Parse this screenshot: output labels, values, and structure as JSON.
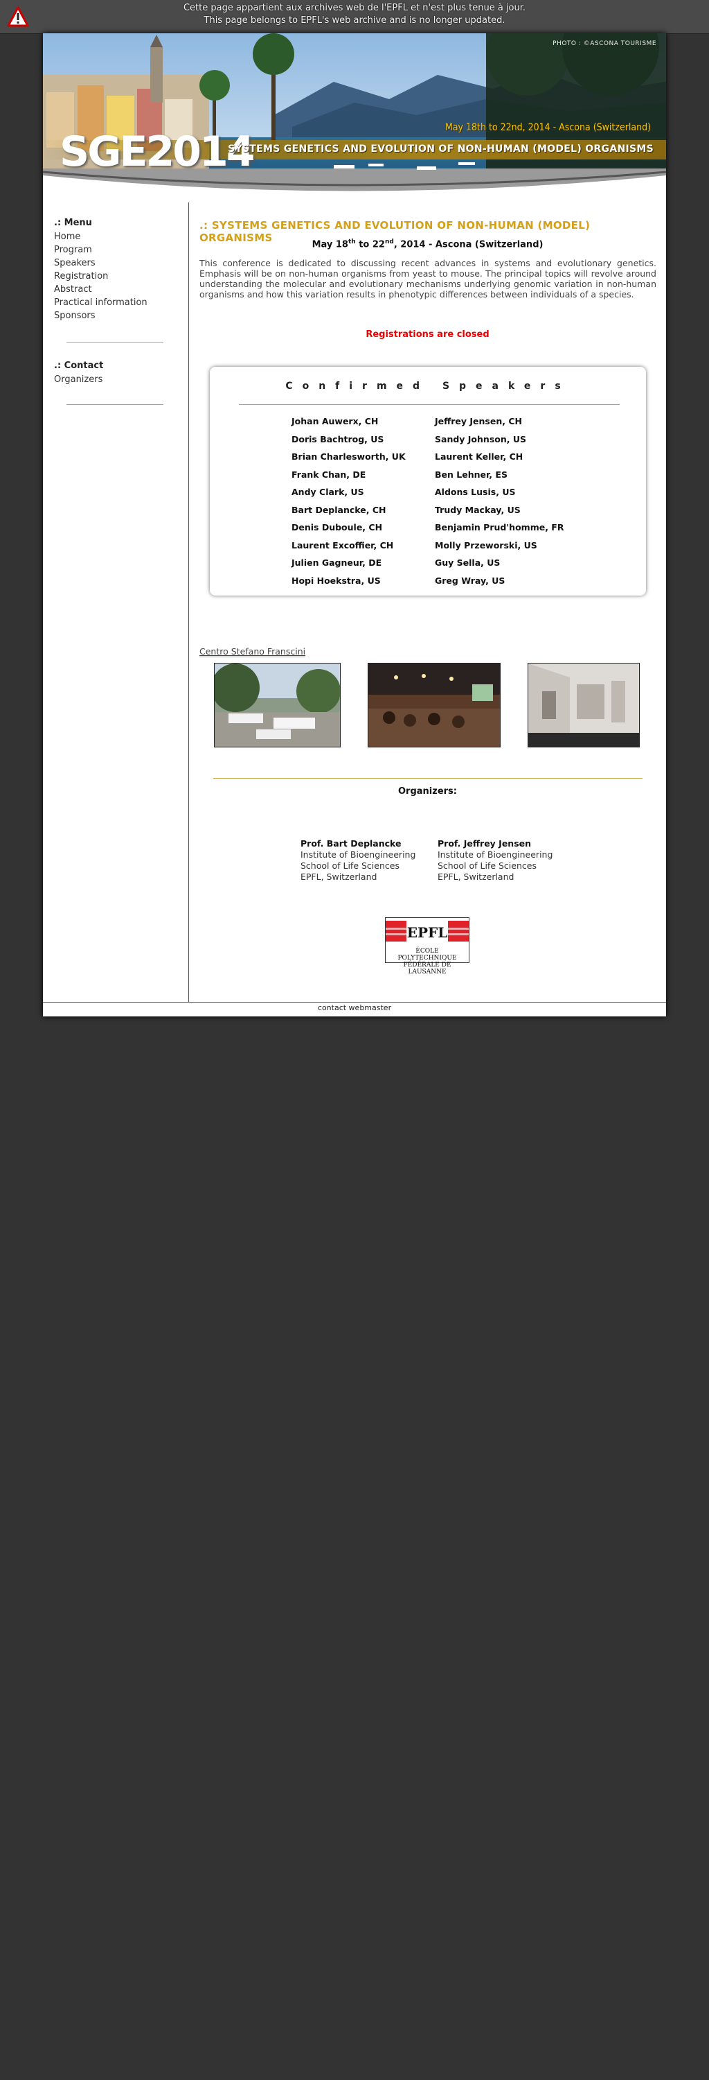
{
  "archive_notice": {
    "line_fr": "Cette page appartient aux archives web de l'EPFL et n'est plus tenue à jour.",
    "line_en": "This page belongs to EPFL's web archive and is no longer updated.",
    "icon": "warning-icon"
  },
  "banner": {
    "photo_credit": "PHOTO : ©ASCONA TOURISME",
    "logo": "SGE2014",
    "dates": "May 18th to 22nd, 2014 - Ascona (Switzerland)",
    "subtitle": "SYSTEMS GENETICS AND EVOLUTION OF NON-HUMAN (MODEL) ORGANISMS"
  },
  "sidebar": {
    "menu_title": ".: Menu",
    "menu_items": [
      "Home",
      "Program",
      "Speakers",
      "Registration",
      "Abstract",
      "Practical information",
      "Sponsors"
    ],
    "contact_title": ".: Contact",
    "contact_items": [
      "Organizers"
    ]
  },
  "main": {
    "title": ".: SYSTEMS GENETICS AND EVOLUTION OF NON-HUMAN (MODEL) ORGANISMS",
    "date_parts": {
      "month": "May 18",
      "sup1": "th",
      "to": " to 22",
      "sup2": "nd",
      "rest": ", 2014 - Ascona (Switzerland)"
    },
    "intro": "This conference is dedicated to discussing recent advances in systems and evolutionary genetics. Emphasis will be on non-human organisms from yeast to mouse. The principal topics will revolve around understanding the molecular and evolutionary mechanisms underlying genomic variation in non-human organisms and how this variation results in phenotypic differences between individuals of a species.",
    "registration_status": "Registrations are closed",
    "speakers_heading": "Confirmed Speakers",
    "speakers_left": [
      "Johan Auwerx, CH",
      "Doris Bachtrog, US",
      "Brian Charlesworth, UK",
      "Frank Chan, DE",
      "Andy Clark, US",
      "Bart Deplancke, CH",
      "Denis Duboule, CH",
      "Laurent Excoffier, CH",
      "Julien Gagneur, DE",
      "Hopi Hoekstra, US"
    ],
    "speakers_right": [
      "Jeffrey Jensen, CH",
      "Sandy Johnson, US",
      "Laurent Keller, CH",
      "Ben Lehner, ES",
      "Aldons Lusis, US",
      "Trudy Mackay, US",
      "Benjamin Prud'homme, FR",
      "Molly Przeworski, US",
      "Guy Sella, US",
      "Greg Wray, US"
    ],
    "venue_label": "Centro Stefano Franscini",
    "organizers_title": "Organizers:",
    "organizers": [
      {
        "name": "Prof. Bart Deplancke",
        "line1": "Institute of Bioengineering",
        "line2": "School of Life Sciences",
        "line3": "EPFL, Switzerland"
      },
      {
        "name": "Prof. Jeffrey Jensen",
        "line1": "Institute of Bioengineering",
        "line2": "School of Life Sciences",
        "line3": "EPFL, Switzerland"
      }
    ],
    "epfl_logo": {
      "mark": "EPFL",
      "caption1": "ÉCOLE POLYTECHNIQUE",
      "caption2": "FÉDÉRALE DE LAUSANNE"
    }
  },
  "footer": {
    "contact": "contact webmaster"
  }
}
